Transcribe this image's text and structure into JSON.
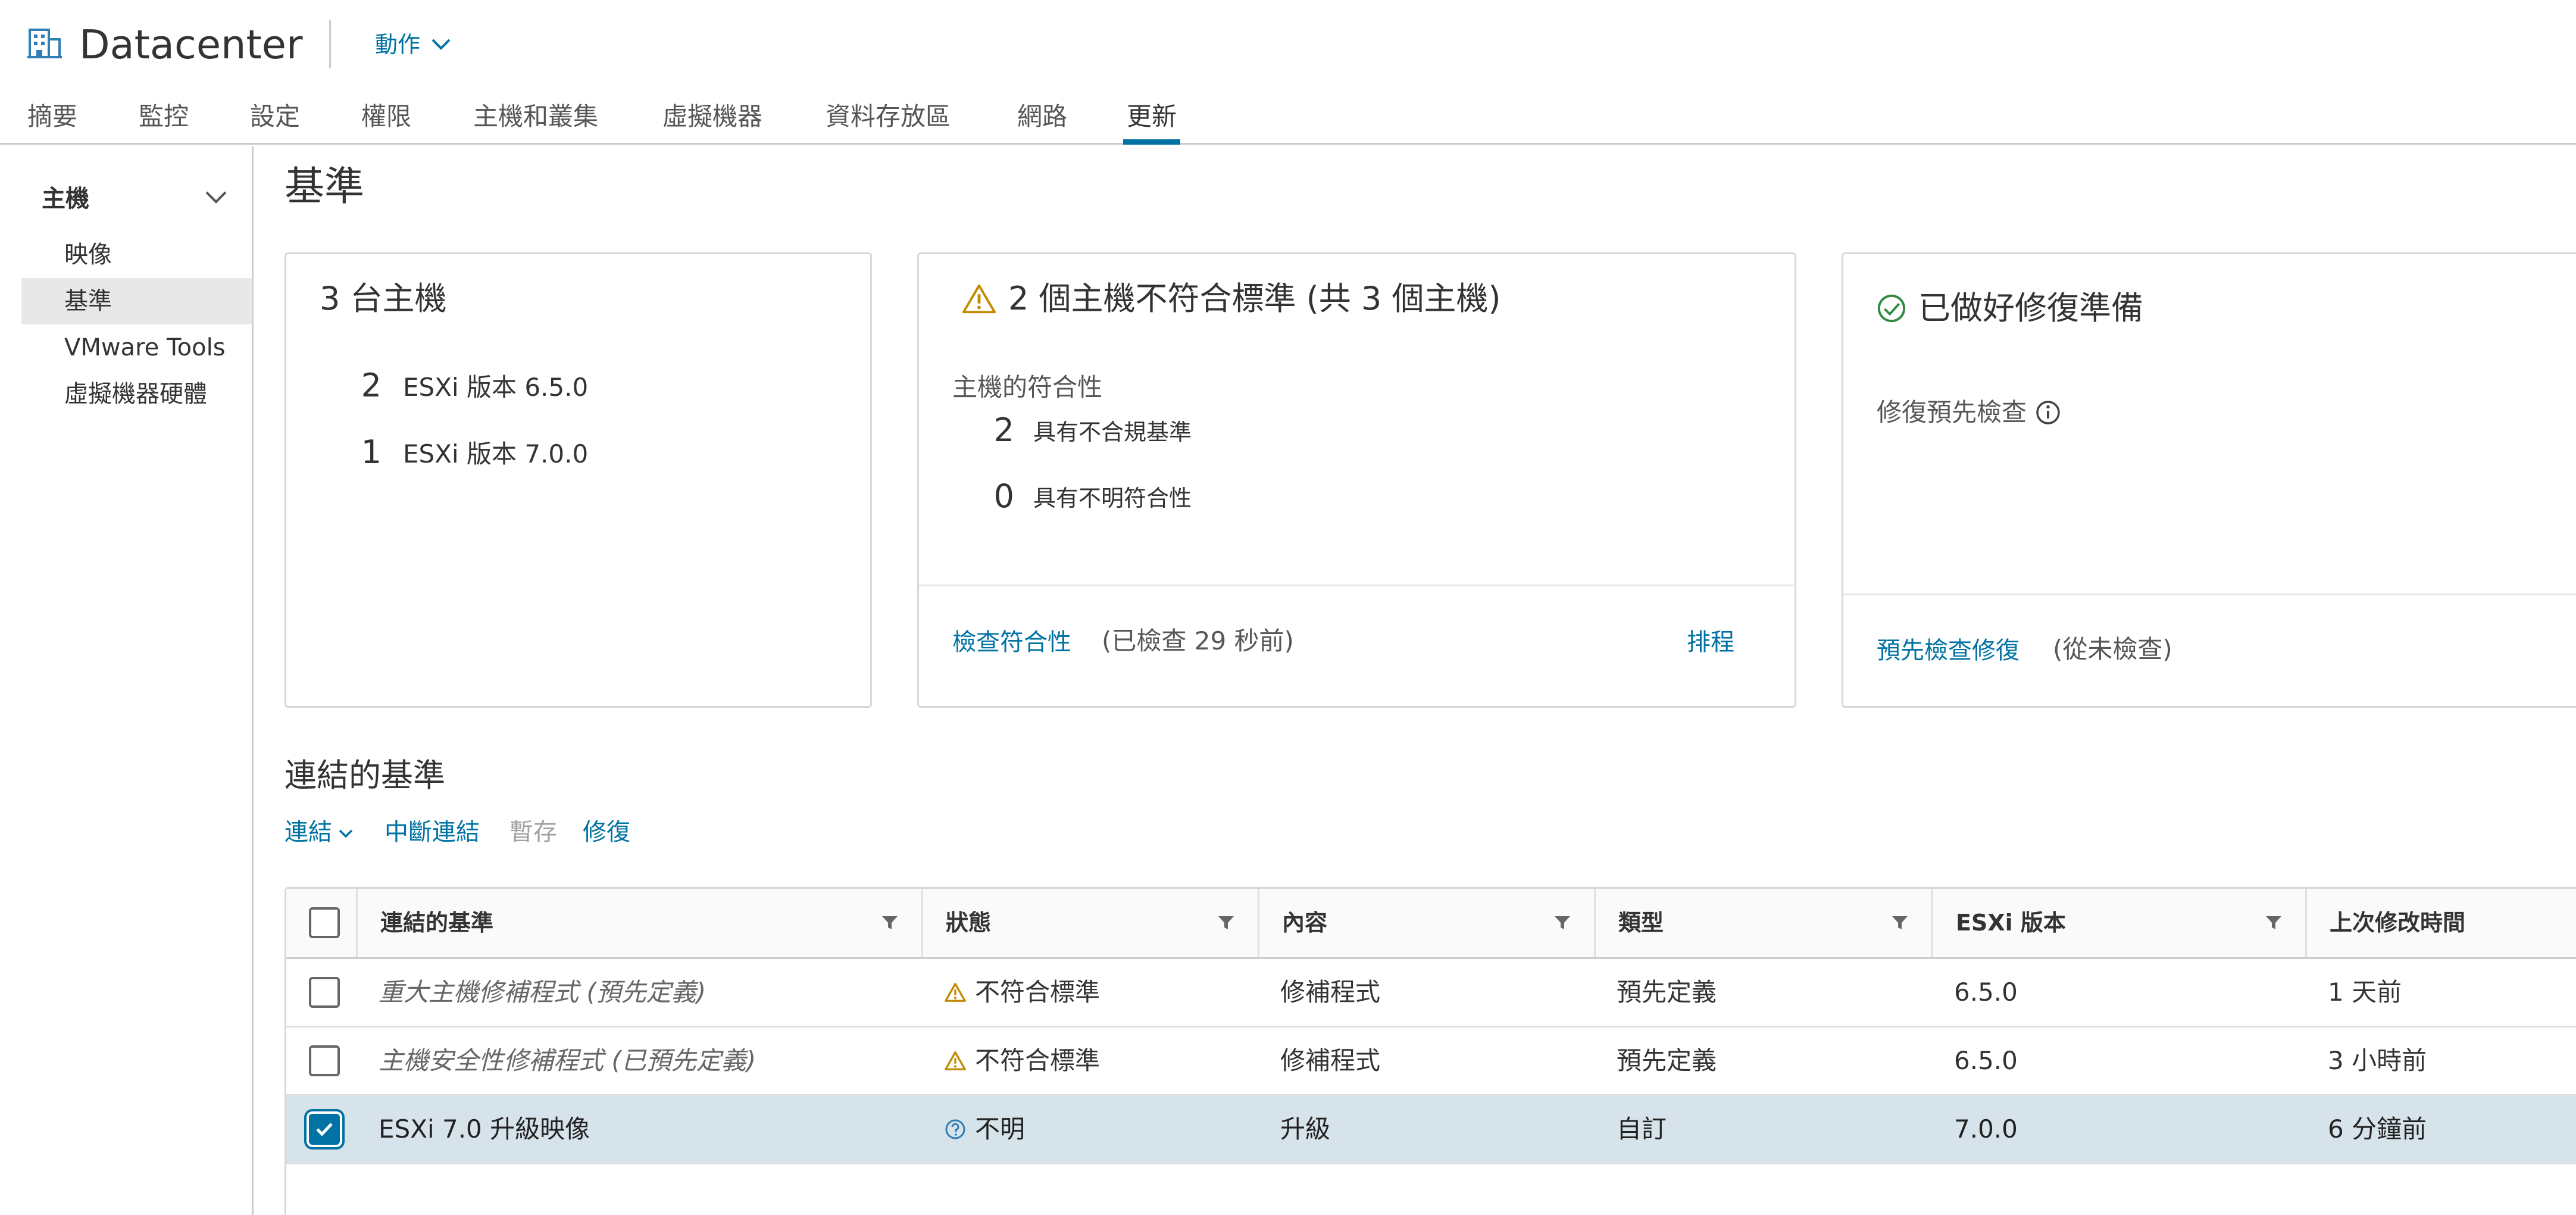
{
  "header": {
    "title": "Datacenter",
    "actions_label": "動作"
  },
  "tabs": [
    {
      "label": "摘要"
    },
    {
      "label": "監控"
    },
    {
      "label": "設定"
    },
    {
      "label": "權限"
    },
    {
      "label": "主機和叢集"
    },
    {
      "label": "虛擬機器"
    },
    {
      "label": "資料存放區"
    },
    {
      "label": "網路"
    },
    {
      "label": "更新",
      "active": true
    }
  ],
  "sidebar": {
    "heading": "主機",
    "items": [
      {
        "label": "映像"
      },
      {
        "label": "基準",
        "active": true
      },
      {
        "label": "VMware Tools"
      },
      {
        "label": "虛擬機器硬體"
      }
    ]
  },
  "page_title": "基準",
  "hosts_card": {
    "title": "3 台主機",
    "rows": [
      {
        "count": "2",
        "label": "ESXi 版本 6.5.0"
      },
      {
        "count": "1",
        "label": "ESXi 版本 7.0.0"
      }
    ]
  },
  "compliance_card": {
    "title": "2 個主機不符合標準 (共 3 個主機)",
    "subtitle": "主機的符合性",
    "rows": [
      {
        "count": "2",
        "label": "具有不合規基準"
      },
      {
        "count": "0",
        "label": "具有不明符合性"
      }
    ],
    "check_link": "檢查符合性",
    "check_note": "(已檢查 29 秒前)",
    "schedule_link": "排程"
  },
  "remediation_card": {
    "title": "已做好修復準備",
    "subtitle": "修復預先檢查",
    "precheck_link": "預先檢查修復",
    "precheck_note": "(從未檢查)"
  },
  "attached": {
    "title": "連結的基準",
    "toolbar": {
      "attach": "連結",
      "detach": "中斷連結",
      "stage": "暫存",
      "remediate": "修復"
    },
    "columns": [
      "連結的基準",
      "狀態",
      "內容",
      "類型",
      "ESXi 版本",
      "上次修改時間"
    ],
    "rows": [
      {
        "name": "重大主機修補程式 (預先定義)",
        "status": "不符合標準",
        "status_icon": "warning-icon",
        "content": "修補程式",
        "type": "預先定義",
        "esxi": "6.5.0",
        "modified": "1 天前",
        "checked": false,
        "italic": true
      },
      {
        "name": "主機安全性修補程式 (已預先定義)",
        "status": "不符合標準",
        "status_icon": "warning-icon",
        "content": "修補程式",
        "type": "預先定義",
        "esxi": "6.5.0",
        "modified": "3 小時前",
        "checked": false,
        "italic": true
      },
      {
        "name": "ESXi 7.0 升級映像",
        "status": "不明",
        "status_icon": "unknown-icon",
        "content": "升級",
        "type": "自訂",
        "esxi": "7.0.0",
        "modified": "6 分鐘前",
        "checked": true,
        "italic": false
      }
    ]
  },
  "colors": {
    "link": "#0072a3",
    "warning": "#c28a00",
    "success": "#2e8a3e",
    "selected_row": "#d6e3ea"
  }
}
